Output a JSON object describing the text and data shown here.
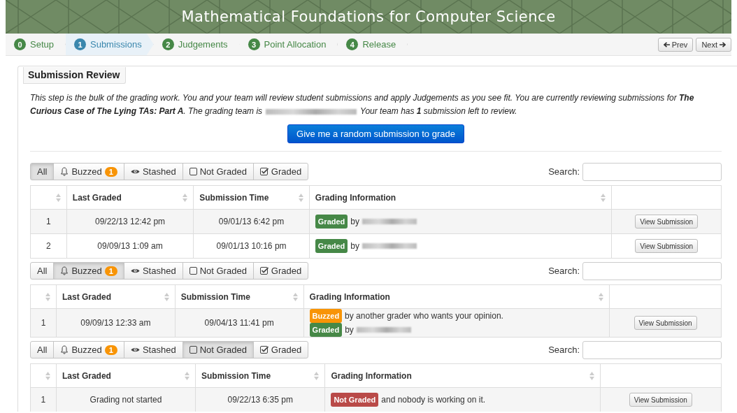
{
  "header": {
    "title": "Mathematical Foundations for Computer Science"
  },
  "steps": [
    {
      "number": "0",
      "label": "Setup",
      "selected": false
    },
    {
      "number": "1",
      "label": "Submissions",
      "selected": true
    },
    {
      "number": "2",
      "label": "Judgements",
      "selected": false
    },
    {
      "number": "3",
      "label": "Point Allocation",
      "selected": false
    },
    {
      "number": "4",
      "label": "Release",
      "selected": false
    }
  ],
  "pager": [
    {
      "kind": "prev",
      "label": "Prev"
    },
    {
      "kind": "next",
      "label": "Next"
    }
  ],
  "panel": {
    "title": "Submission Review",
    "intro_before": "This step is the bulk of the grading work. You and your team will review student submissions and apply Judgements as you see fit. You are currently reviewing submissions for **The Curious Case of The Lying TAs: Part A**. The grading team is",
    "intro_after": "Your team has **1** submission left to review.",
    "random_button": "Give me a random submission to grade",
    "tables": [
      {
        "filters": [
          {
            "kind": "all",
            "label": "All",
            "selected": true
          },
          {
            "kind": "buzzed",
            "label": "Buzzed",
            "count": "1",
            "selected": false
          },
          {
            "kind": "stashed",
            "label": "Stashed",
            "selected": false
          },
          {
            "kind": "not_graded",
            "label": "Not Graded",
            "selected": false
          },
          {
            "kind": "graded",
            "label": "Graded",
            "selected": false
          }
        ],
        "search_label": "Search:",
        "columns": [
          {
            "sortable": true
          },
          {
            "label": "Last Graded",
            "sortable": true
          },
          {
            "label": "Submission Time",
            "sortable": true
          },
          {
            "label": "Grading Information",
            "sortable": true
          },
          {
            "sortable": false
          }
        ],
        "rows": [
          {
            "index": "1",
            "last_graded": "09/22/13 12:42 pm",
            "submission_time": "09/01/13 6:42 pm",
            "info": [
              {
                "kind": "graded",
                "badge": "Graded",
                "text": "by",
                "redacted": true
              }
            ],
            "action": "View Submission"
          },
          {
            "index": "2",
            "last_graded": "09/09/13 1:09 am",
            "submission_time": "09/01/13 10:16 pm",
            "info": [
              {
                "kind": "graded",
                "badge": "Graded",
                "text": "by",
                "redacted": true
              }
            ],
            "action": "View Submission"
          }
        ]
      },
      {
        "filters": [
          {
            "kind": "all",
            "label": "All",
            "selected": false
          },
          {
            "kind": "buzzed",
            "label": "Buzzed",
            "count": "1",
            "selected": true
          },
          {
            "kind": "stashed",
            "label": "Stashed",
            "selected": false
          },
          {
            "kind": "not_graded",
            "label": "Not Graded",
            "selected": false
          },
          {
            "kind": "graded",
            "label": "Graded",
            "selected": false
          }
        ],
        "search_label": "Search:",
        "columns": [
          {
            "sortable": true
          },
          {
            "label": "Last Graded",
            "sortable": true
          },
          {
            "label": "Submission Time",
            "sortable": true
          },
          {
            "label": "Grading Information",
            "sortable": true
          },
          {
            "sortable": false
          }
        ],
        "rows": [
          {
            "index": "1",
            "last_graded": "09/09/13 12:33 am",
            "submission_time": "09/04/13 11:41 pm",
            "info": [
              {
                "kind": "buzzed",
                "badge": "Buzzed",
                "text": "by another grader who wants your opinion.",
                "redacted": false
              },
              {
                "kind": "graded",
                "badge": "Graded",
                "text": "by",
                "redacted": true
              }
            ],
            "action": "View Submission"
          }
        ]
      },
      {
        "filters": [
          {
            "kind": "all",
            "label": "All",
            "selected": false
          },
          {
            "kind": "buzzed",
            "label": "Buzzed",
            "count": "1",
            "selected": false
          },
          {
            "kind": "stashed",
            "label": "Stashed",
            "selected": false
          },
          {
            "kind": "not_graded",
            "label": "Not Graded",
            "selected": true
          },
          {
            "kind": "graded",
            "label": "Graded",
            "selected": false
          }
        ],
        "search_label": "Search:",
        "columns": [
          {
            "sortable": true
          },
          {
            "label": "Last Graded",
            "sortable": true
          },
          {
            "label": "Submission Time",
            "sortable": true
          },
          {
            "label": "Grading Information",
            "sortable": true
          },
          {
            "sortable": false
          }
        ],
        "rows": [
          {
            "index": "1",
            "last_graded": "Grading not started",
            "submission_time": "09/22/13 6:35 pm",
            "info": [
              {
                "kind": "not_graded",
                "badge": "Not Graded",
                "text": "and nobody is working on it.",
                "redacted": false
              }
            ],
            "action": "View Submission"
          }
        ]
      }
    ]
  }
}
